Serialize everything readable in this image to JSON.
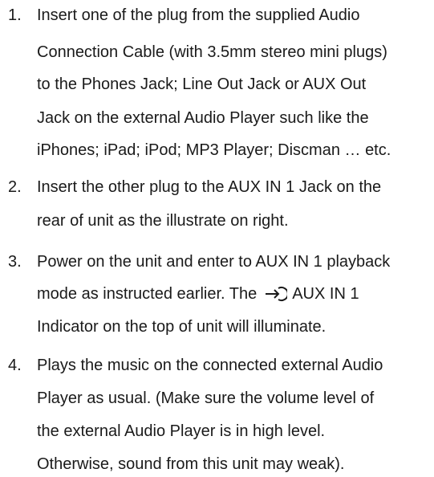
{
  "steps": [
    {
      "number": "1.",
      "lines": [
        "Insert one of the plug from the supplied Audio",
        "Connection Cable (with 3.5mm stereo mini plugs)",
        "to the Phones Jack; Line Out Jack or AUX Out",
        "Jack on the external Audio Player such like the",
        "iPhones; iPad; iPod; MP3 Player; Discman … etc."
      ]
    },
    {
      "number": "2.",
      "lines": [
        "Insert the other plug to the AUX IN 1 Jack on the",
        "rear of unit as the illustrate on right."
      ]
    },
    {
      "number": "3.",
      "lines": [
        "Power on the unit and enter to AUX IN 1 playback",
        "mode as instructed earlier. The",
        "Indicator on the top of unit will illuminate."
      ],
      "indicator_label": "AUX IN 1",
      "indicator_icon": "aux-input-icon"
    },
    {
      "number": "4.",
      "lines": [
        "Plays the music on the connected external Audio",
        "Player as usual. (Make sure the volume level of",
        "the external Audio Player is in high level.",
        "Otherwise, sound from this unit may weak)."
      ]
    }
  ]
}
